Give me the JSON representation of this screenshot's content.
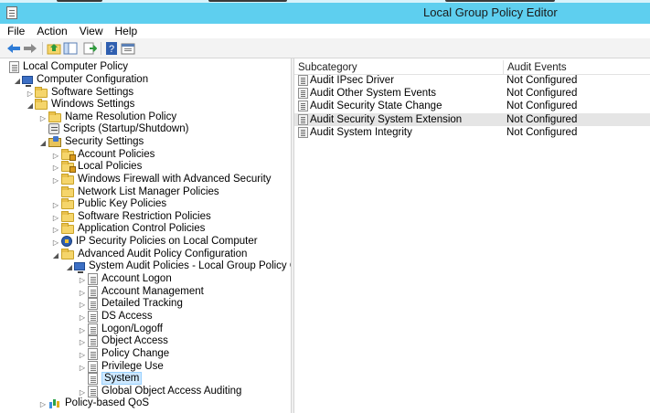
{
  "window": {
    "title": "Local Group Policy Editor"
  },
  "menu": [
    "File",
    "Action",
    "View",
    "Help"
  ],
  "toolbar": {
    "buttons": [
      "back-arrow-icon",
      "forward-arrow-icon",
      "up-folder-icon",
      "show-hide-tree-icon",
      "export-list-icon",
      "help-icon",
      "properties-icon"
    ]
  },
  "tree": {
    "items": [
      "Local Computer Policy",
      "Computer Configuration",
      "Software Settings",
      "Windows Settings",
      "Name Resolution Policy",
      "Scripts (Startup/Shutdown)",
      "Security Settings",
      "Account Policies",
      "Local Policies",
      "Windows Firewall with Advanced Security",
      "Network List Manager Policies",
      "Public Key Policies",
      "Software Restriction Policies",
      "Application Control Policies",
      "IP Security Policies on Local Computer",
      "Advanced Audit Policy Configuration",
      "System Audit Policies - Local Group Policy Object",
      "Account Logon",
      "Account Management",
      "Detailed Tracking",
      "DS Access",
      "Logon/Logoff",
      "Object Access",
      "Policy Change",
      "Privilege Use",
      "System",
      "Global Object Access Auditing",
      "Policy-based QoS"
    ],
    "selected": "System"
  },
  "list": {
    "columns": [
      "Subcategory",
      "Audit Events"
    ],
    "rows": [
      {
        "subcategory": "Audit IPsec Driver",
        "audit_events": "Not Configured"
      },
      {
        "subcategory": "Audit Other System Events",
        "audit_events": "Not Configured"
      },
      {
        "subcategory": "Audit Security State Change",
        "audit_events": "Not Configured"
      },
      {
        "subcategory": "Audit Security System Extension",
        "audit_events": "Not Configured"
      },
      {
        "subcategory": "Audit System Integrity",
        "audit_events": "Not Configured"
      }
    ],
    "highlighted_row": "Audit Security System Extension"
  },
  "colors": {
    "titlebar": "#5ecfef",
    "selection": "#cde8ff",
    "row_highlight": "#e5e5e5"
  }
}
